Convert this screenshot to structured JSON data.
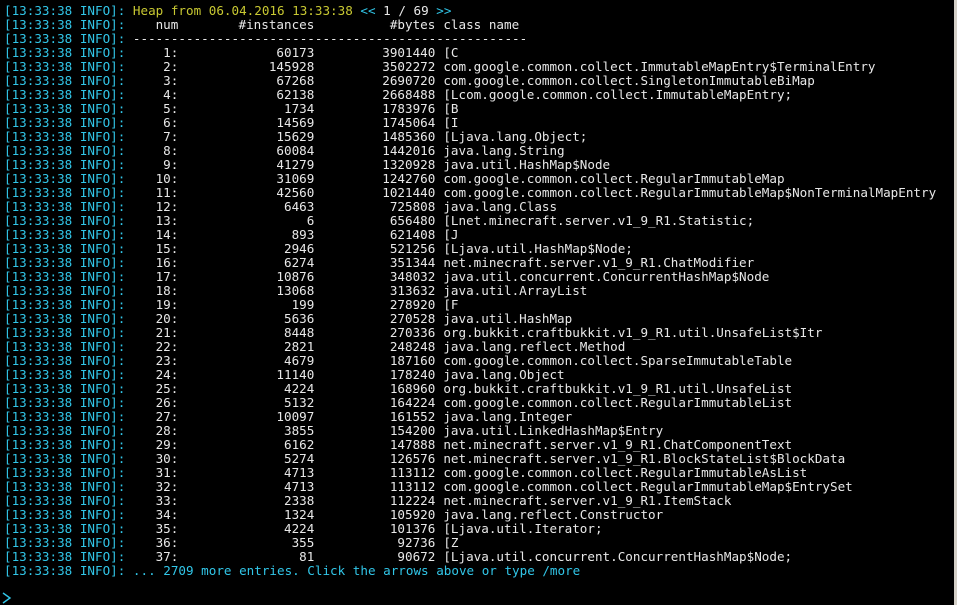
{
  "colors": {
    "background": "#000000",
    "prefix": "#31c6e8",
    "header_text": "#c8c832",
    "nav": "#31c6e8",
    "body_text": "#e8e8e8",
    "footer_text": "#31c6e8"
  },
  "log_prefix": "[13:33:38 INFO]:",
  "header": {
    "title": "Heap from 06.04.2016 13:33:38",
    "prev_arrows": "<<",
    "page": "1 / 69",
    "next_arrows": ">>"
  },
  "columns": {
    "num": "num",
    "instances": "#instances",
    "bytes": "#bytes",
    "class_name": "class name"
  },
  "separator": "----------------------------------------------------",
  "rows": [
    {
      "num": "1:",
      "instances": "60173",
      "bytes": "3901440",
      "class_name": "[C"
    },
    {
      "num": "2:",
      "instances": "145928",
      "bytes": "3502272",
      "class_name": "com.google.common.collect.ImmutableMapEntry$TerminalEntry"
    },
    {
      "num": "3:",
      "instances": "67268",
      "bytes": "2690720",
      "class_name": "com.google.common.collect.SingletonImmutableBiMap"
    },
    {
      "num": "4:",
      "instances": "62138",
      "bytes": "2668488",
      "class_name": "[Lcom.google.common.collect.ImmutableMapEntry;"
    },
    {
      "num": "5:",
      "instances": "1734",
      "bytes": "1783976",
      "class_name": "[B"
    },
    {
      "num": "6:",
      "instances": "14569",
      "bytes": "1745064",
      "class_name": "[I"
    },
    {
      "num": "7:",
      "instances": "15629",
      "bytes": "1485360",
      "class_name": "[Ljava.lang.Object;"
    },
    {
      "num": "8:",
      "instances": "60084",
      "bytes": "1442016",
      "class_name": "java.lang.String"
    },
    {
      "num": "9:",
      "instances": "41279",
      "bytes": "1320928",
      "class_name": "java.util.HashMap$Node"
    },
    {
      "num": "10:",
      "instances": "31069",
      "bytes": "1242760",
      "class_name": "com.google.common.collect.RegularImmutableMap"
    },
    {
      "num": "11:",
      "instances": "42560",
      "bytes": "1021440",
      "class_name": "com.google.common.collect.RegularImmutableMap$NonTerminalMapEntry"
    },
    {
      "num": "12:",
      "instances": "6463",
      "bytes": "725808",
      "class_name": "java.lang.Class"
    },
    {
      "num": "13:",
      "instances": "6",
      "bytes": "656480",
      "class_name": "[Lnet.minecraft.server.v1_9_R1.Statistic;"
    },
    {
      "num": "14:",
      "instances": "893",
      "bytes": "621408",
      "class_name": "[J"
    },
    {
      "num": "15:",
      "instances": "2946",
      "bytes": "521256",
      "class_name": "[Ljava.util.HashMap$Node;"
    },
    {
      "num": "16:",
      "instances": "6274",
      "bytes": "351344",
      "class_name": "net.minecraft.server.v1_9_R1.ChatModifier"
    },
    {
      "num": "17:",
      "instances": "10876",
      "bytes": "348032",
      "class_name": "java.util.concurrent.ConcurrentHashMap$Node"
    },
    {
      "num": "18:",
      "instances": "13068",
      "bytes": "313632",
      "class_name": "java.util.ArrayList"
    },
    {
      "num": "19:",
      "instances": "199",
      "bytes": "278920",
      "class_name": "[F"
    },
    {
      "num": "20:",
      "instances": "5636",
      "bytes": "270528",
      "class_name": "java.util.HashMap"
    },
    {
      "num": "21:",
      "instances": "8448",
      "bytes": "270336",
      "class_name": "org.bukkit.craftbukkit.v1_9_R1.util.UnsafeList$Itr"
    },
    {
      "num": "22:",
      "instances": "2821",
      "bytes": "248248",
      "class_name": "java.lang.reflect.Method"
    },
    {
      "num": "23:",
      "instances": "4679",
      "bytes": "187160",
      "class_name": "com.google.common.collect.SparseImmutableTable"
    },
    {
      "num": "24:",
      "instances": "11140",
      "bytes": "178240",
      "class_name": "java.lang.Object"
    },
    {
      "num": "25:",
      "instances": "4224",
      "bytes": "168960",
      "class_name": "org.bukkit.craftbukkit.v1_9_R1.util.UnsafeList"
    },
    {
      "num": "26:",
      "instances": "5132",
      "bytes": "164224",
      "class_name": "com.google.common.collect.RegularImmutableList"
    },
    {
      "num": "27:",
      "instances": "10097",
      "bytes": "161552",
      "class_name": "java.lang.Integer"
    },
    {
      "num": "28:",
      "instances": "3855",
      "bytes": "154200",
      "class_name": "java.util.LinkedHashMap$Entry"
    },
    {
      "num": "29:",
      "instances": "6162",
      "bytes": "147888",
      "class_name": "net.minecraft.server.v1_9_R1.ChatComponentText"
    },
    {
      "num": "30:",
      "instances": "5274",
      "bytes": "126576",
      "class_name": "net.minecraft.server.v1_9_R1.BlockStateList$BlockData"
    },
    {
      "num": "31:",
      "instances": "4713",
      "bytes": "113112",
      "class_name": "com.google.common.collect.RegularImmutableAsList"
    },
    {
      "num": "32:",
      "instances": "4713",
      "bytes": "113112",
      "class_name": "com.google.common.collect.RegularImmutableMap$EntrySet"
    },
    {
      "num": "33:",
      "instances": "2338",
      "bytes": "112224",
      "class_name": "net.minecraft.server.v1_9_R1.ItemStack"
    },
    {
      "num": "34:",
      "instances": "1324",
      "bytes": "105920",
      "class_name": "java.lang.reflect.Constructor"
    },
    {
      "num": "35:",
      "instances": "4224",
      "bytes": "101376",
      "class_name": "[Ljava.util.Iterator;"
    },
    {
      "num": "36:",
      "instances": "355",
      "bytes": "92736",
      "class_name": "[Z"
    },
    {
      "num": "37:",
      "instances": "81",
      "bytes": "90672",
      "class_name": "[Ljava.util.concurrent.ConcurrentHashMap$Node;"
    }
  ],
  "footer": "... 2709 more entries. Click the arrows above or type /more",
  "prompt": ">"
}
